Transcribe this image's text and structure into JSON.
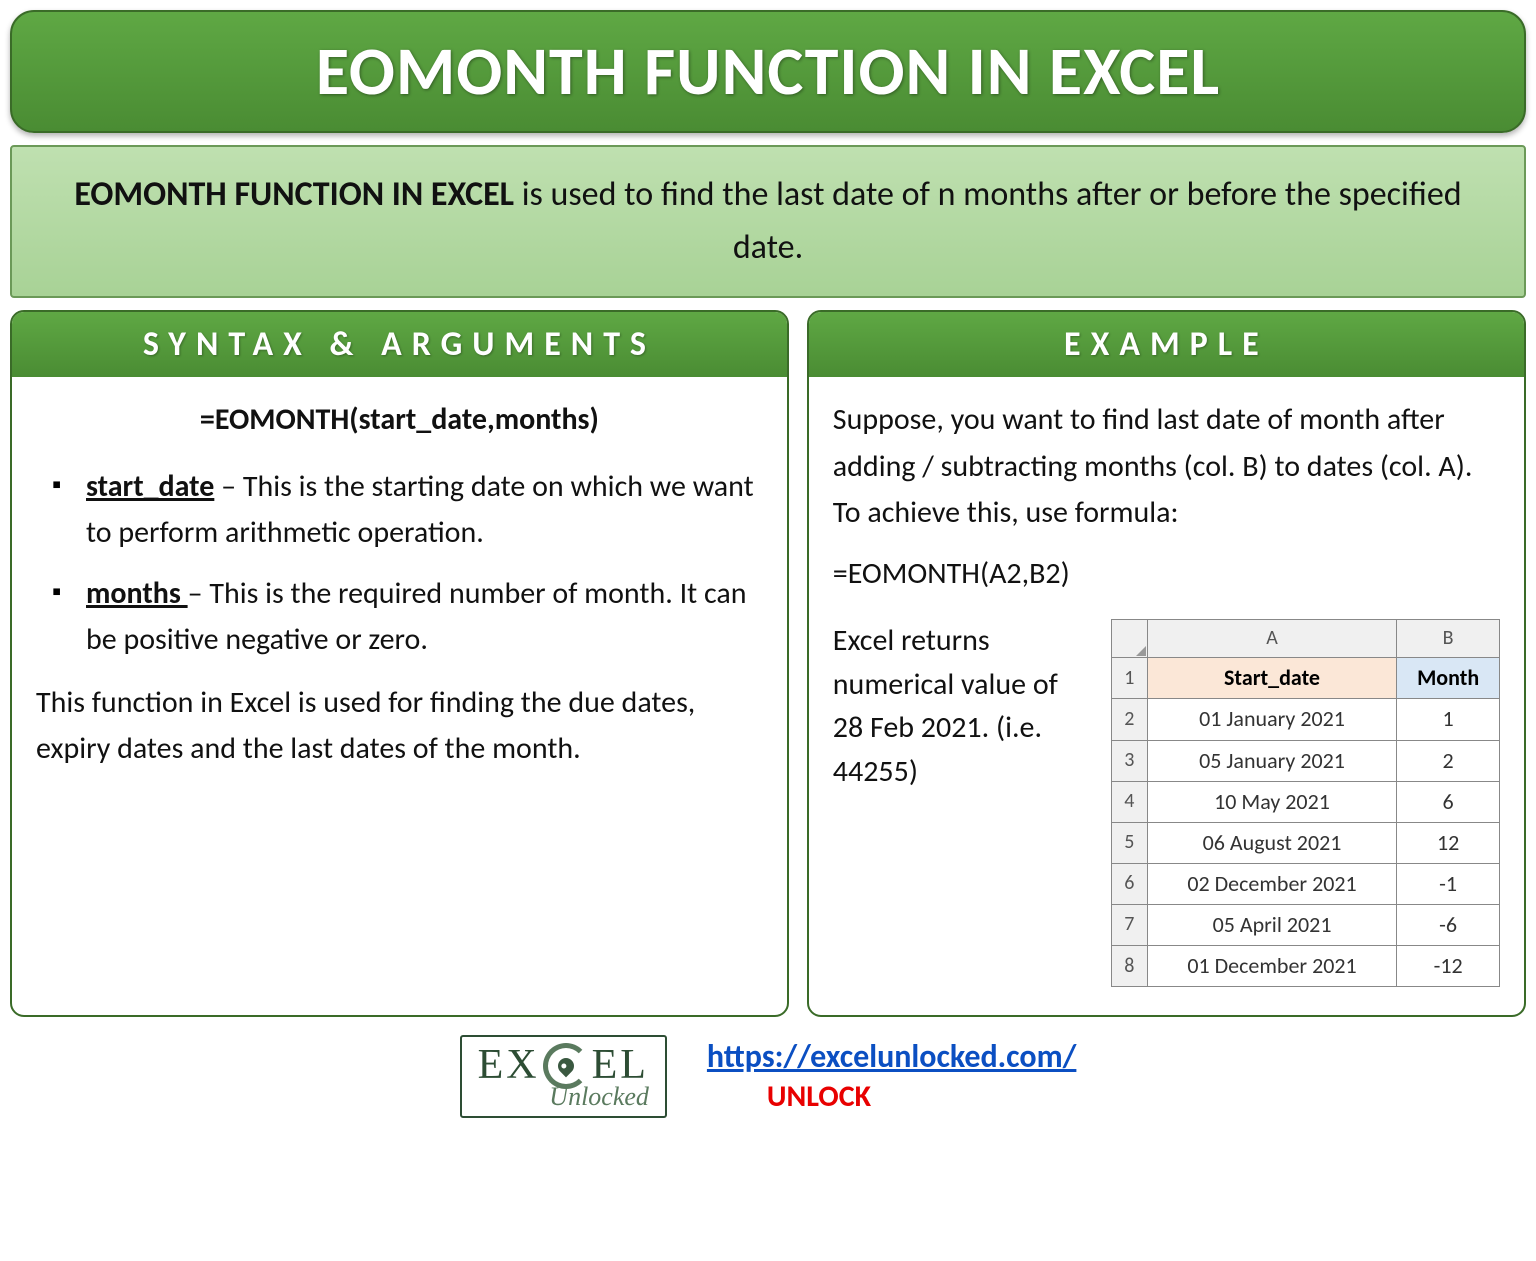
{
  "title": "EOMONTH FUNCTION IN EXCEL",
  "description": {
    "bold": "EOMONTH FUNCTION IN EXCEL",
    "rest": " is used to find the last date of n months after or before the specified date."
  },
  "syntax": {
    "heading": "SYNTAX & ARGUMENTS",
    "formula": "=EOMONTH(start_date,months)",
    "args": [
      {
        "name": "start_date",
        "text": " – This is the starting date on which we want to perform arithmetic operation."
      },
      {
        "name": "months ",
        "text": "– This is the required number of month. It can be positive negative or zero."
      }
    ],
    "note": "This function in Excel is used for finding the due dates, expiry dates and the last dates of the month."
  },
  "example": {
    "heading": "EXAMPLE",
    "intro": "Suppose, you want to find last date of month after adding / subtracting months (col. B) to dates (col. A). To achieve this, use formula:",
    "formula": "=EOMONTH(A2,B2)",
    "result_note": "Excel returns numerical value of 28 Feb 2021. (i.e. 44255)",
    "table": {
      "col_labels": [
        "A",
        "B"
      ],
      "headers": [
        "Start_date",
        "Month"
      ],
      "rows": [
        {
          "n": "1",
          "a": "Start_date",
          "b": "Month"
        },
        {
          "n": "2",
          "a": "01 January 2021",
          "b": "1"
        },
        {
          "n": "3",
          "a": "05 January 2021",
          "b": "2"
        },
        {
          "n": "4",
          "a": "10 May 2021",
          "b": "6"
        },
        {
          "n": "5",
          "a": "06 August 2021",
          "b": "12"
        },
        {
          "n": "6",
          "a": "02 December 2021",
          "b": "-1"
        },
        {
          "n": "7",
          "a": "05 April 2021",
          "b": "-6"
        },
        {
          "n": "8",
          "a": "01 December 2021",
          "b": "-12"
        }
      ]
    }
  },
  "footer": {
    "logo_top_left": "EX",
    "logo_top_right": "EL",
    "logo_bottom": "Unlocked",
    "url": "https://excelunlocked.com/",
    "unlock": "UNLOCK"
  }
}
